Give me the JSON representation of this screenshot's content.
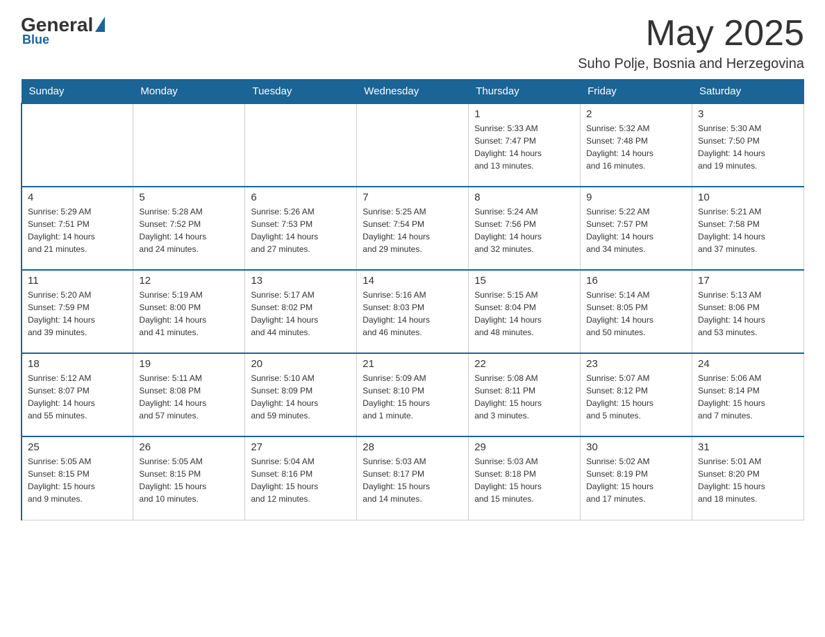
{
  "header": {
    "logo_general": "General",
    "logo_blue": "Blue",
    "month_title": "May 2025",
    "location": "Suho Polje, Bosnia and Herzegovina"
  },
  "weekdays": [
    "Sunday",
    "Monday",
    "Tuesday",
    "Wednesday",
    "Thursday",
    "Friday",
    "Saturday"
  ],
  "weeks": [
    [
      {
        "day": "",
        "info": ""
      },
      {
        "day": "",
        "info": ""
      },
      {
        "day": "",
        "info": ""
      },
      {
        "day": "",
        "info": ""
      },
      {
        "day": "1",
        "info": "Sunrise: 5:33 AM\nSunset: 7:47 PM\nDaylight: 14 hours\nand 13 minutes."
      },
      {
        "day": "2",
        "info": "Sunrise: 5:32 AM\nSunset: 7:48 PM\nDaylight: 14 hours\nand 16 minutes."
      },
      {
        "day": "3",
        "info": "Sunrise: 5:30 AM\nSunset: 7:50 PM\nDaylight: 14 hours\nand 19 minutes."
      }
    ],
    [
      {
        "day": "4",
        "info": "Sunrise: 5:29 AM\nSunset: 7:51 PM\nDaylight: 14 hours\nand 21 minutes."
      },
      {
        "day": "5",
        "info": "Sunrise: 5:28 AM\nSunset: 7:52 PM\nDaylight: 14 hours\nand 24 minutes."
      },
      {
        "day": "6",
        "info": "Sunrise: 5:26 AM\nSunset: 7:53 PM\nDaylight: 14 hours\nand 27 minutes."
      },
      {
        "day": "7",
        "info": "Sunrise: 5:25 AM\nSunset: 7:54 PM\nDaylight: 14 hours\nand 29 minutes."
      },
      {
        "day": "8",
        "info": "Sunrise: 5:24 AM\nSunset: 7:56 PM\nDaylight: 14 hours\nand 32 minutes."
      },
      {
        "day": "9",
        "info": "Sunrise: 5:22 AM\nSunset: 7:57 PM\nDaylight: 14 hours\nand 34 minutes."
      },
      {
        "day": "10",
        "info": "Sunrise: 5:21 AM\nSunset: 7:58 PM\nDaylight: 14 hours\nand 37 minutes."
      }
    ],
    [
      {
        "day": "11",
        "info": "Sunrise: 5:20 AM\nSunset: 7:59 PM\nDaylight: 14 hours\nand 39 minutes."
      },
      {
        "day": "12",
        "info": "Sunrise: 5:19 AM\nSunset: 8:00 PM\nDaylight: 14 hours\nand 41 minutes."
      },
      {
        "day": "13",
        "info": "Sunrise: 5:17 AM\nSunset: 8:02 PM\nDaylight: 14 hours\nand 44 minutes."
      },
      {
        "day": "14",
        "info": "Sunrise: 5:16 AM\nSunset: 8:03 PM\nDaylight: 14 hours\nand 46 minutes."
      },
      {
        "day": "15",
        "info": "Sunrise: 5:15 AM\nSunset: 8:04 PM\nDaylight: 14 hours\nand 48 minutes."
      },
      {
        "day": "16",
        "info": "Sunrise: 5:14 AM\nSunset: 8:05 PM\nDaylight: 14 hours\nand 50 minutes."
      },
      {
        "day": "17",
        "info": "Sunrise: 5:13 AM\nSunset: 8:06 PM\nDaylight: 14 hours\nand 53 minutes."
      }
    ],
    [
      {
        "day": "18",
        "info": "Sunrise: 5:12 AM\nSunset: 8:07 PM\nDaylight: 14 hours\nand 55 minutes."
      },
      {
        "day": "19",
        "info": "Sunrise: 5:11 AM\nSunset: 8:08 PM\nDaylight: 14 hours\nand 57 minutes."
      },
      {
        "day": "20",
        "info": "Sunrise: 5:10 AM\nSunset: 8:09 PM\nDaylight: 14 hours\nand 59 minutes."
      },
      {
        "day": "21",
        "info": "Sunrise: 5:09 AM\nSunset: 8:10 PM\nDaylight: 15 hours\nand 1 minute."
      },
      {
        "day": "22",
        "info": "Sunrise: 5:08 AM\nSunset: 8:11 PM\nDaylight: 15 hours\nand 3 minutes."
      },
      {
        "day": "23",
        "info": "Sunrise: 5:07 AM\nSunset: 8:12 PM\nDaylight: 15 hours\nand 5 minutes."
      },
      {
        "day": "24",
        "info": "Sunrise: 5:06 AM\nSunset: 8:14 PM\nDaylight: 15 hours\nand 7 minutes."
      }
    ],
    [
      {
        "day": "25",
        "info": "Sunrise: 5:05 AM\nSunset: 8:15 PM\nDaylight: 15 hours\nand 9 minutes."
      },
      {
        "day": "26",
        "info": "Sunrise: 5:05 AM\nSunset: 8:15 PM\nDaylight: 15 hours\nand 10 minutes."
      },
      {
        "day": "27",
        "info": "Sunrise: 5:04 AM\nSunset: 8:16 PM\nDaylight: 15 hours\nand 12 minutes."
      },
      {
        "day": "28",
        "info": "Sunrise: 5:03 AM\nSunset: 8:17 PM\nDaylight: 15 hours\nand 14 minutes."
      },
      {
        "day": "29",
        "info": "Sunrise: 5:03 AM\nSunset: 8:18 PM\nDaylight: 15 hours\nand 15 minutes."
      },
      {
        "day": "30",
        "info": "Sunrise: 5:02 AM\nSunset: 8:19 PM\nDaylight: 15 hours\nand 17 minutes."
      },
      {
        "day": "31",
        "info": "Sunrise: 5:01 AM\nSunset: 8:20 PM\nDaylight: 15 hours\nand 18 minutes."
      }
    ]
  ]
}
